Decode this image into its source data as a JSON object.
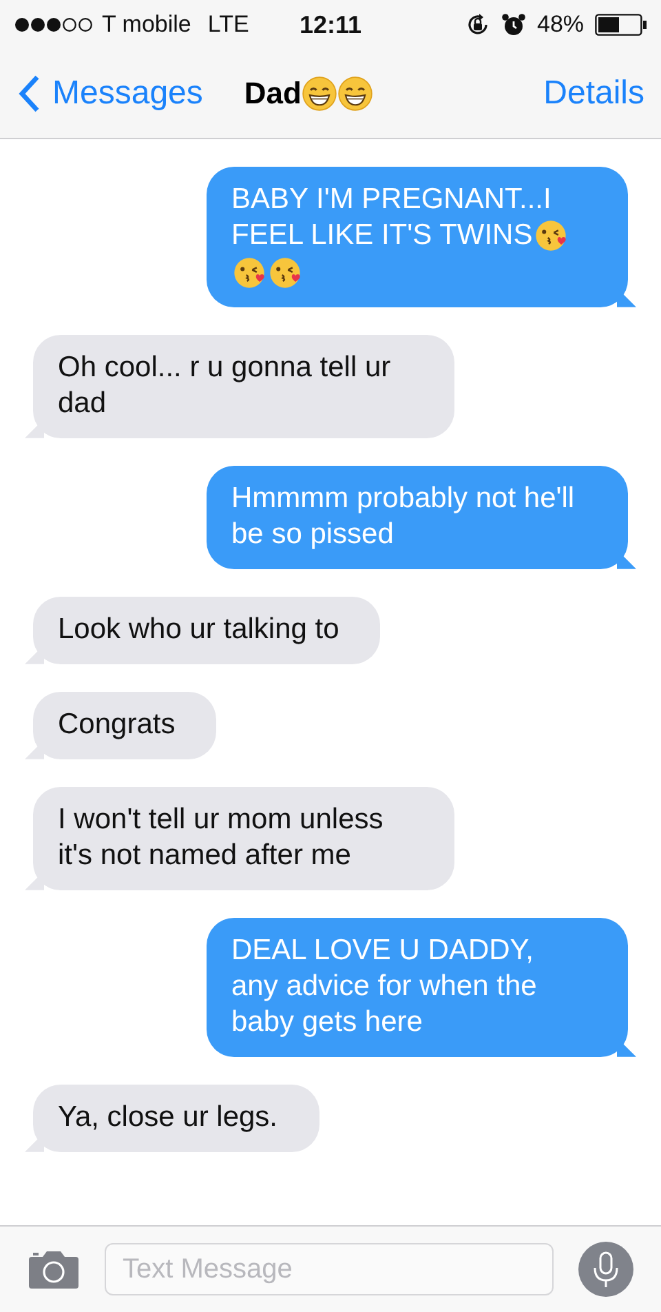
{
  "status_bar": {
    "carrier": "T mobile",
    "network": "LTE",
    "time": "12:11",
    "battery": "48%"
  },
  "nav": {
    "back": "Messages",
    "title": "Dad",
    "title_icons": [
      {
        "kind": "grin"
      },
      {
        "kind": "grin"
      }
    ],
    "action": "Details"
  },
  "messages": [
    {
      "kind": "sent",
      "text": "BABY I'M PREGNANT...I FEEL LIKE IT'S TWINS",
      "icons": [
        {
          "kind": "kiss"
        },
        {
          "kind": "kiss"
        },
        {
          "kind": "kiss"
        }
      ]
    },
    {
      "kind": "received",
      "text": "Oh cool... r u gonna tell ur dad"
    },
    {
      "kind": "sent",
      "text": "Hmmmm probably not he'll be so pissed"
    },
    {
      "kind": "received",
      "text": "Look who ur talking to"
    },
    {
      "kind": "received",
      "text": "Congrats"
    },
    {
      "kind": "received",
      "text": "I won't tell ur mom unless it's not named after me"
    },
    {
      "kind": "sent",
      "text": "DEAL LOVE U DADDY, any advice for when the baby gets here"
    },
    {
      "kind": "received",
      "text": "Ya, close ur legs."
    }
  ],
  "composer": {
    "placeholder": "Text Message"
  }
}
